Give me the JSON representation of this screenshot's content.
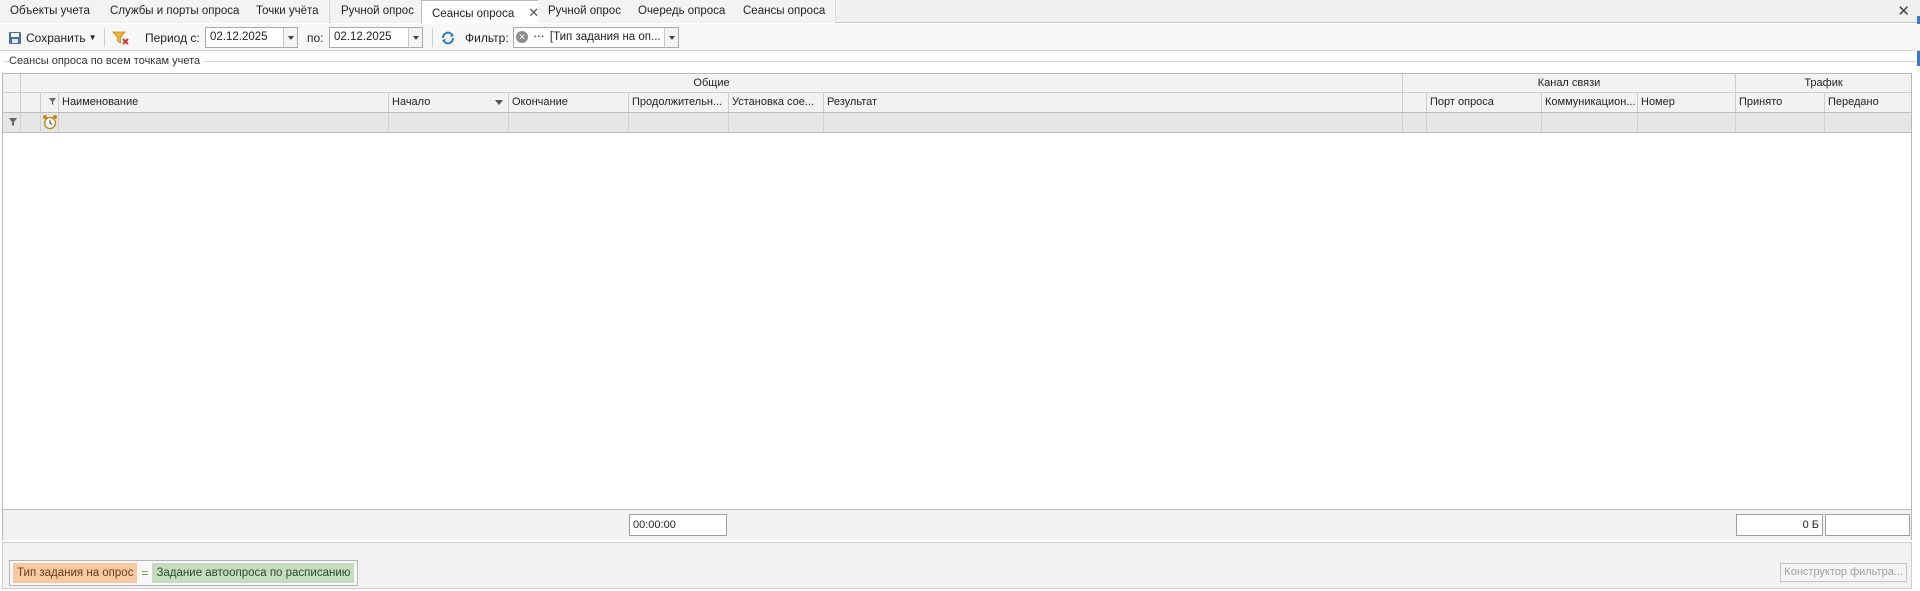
{
  "tabs": [
    {
      "label": "Объекты учета",
      "active": false
    },
    {
      "label": "Службы и порты опроса",
      "active": false
    },
    {
      "label": "Точки учёта",
      "active": false
    },
    {
      "label": "Ручной опрос",
      "active": false
    },
    {
      "label": "Сеансы опроса",
      "active": true
    },
    {
      "label": "Ручной опрос",
      "active": false
    },
    {
      "label": "Очередь опроса",
      "active": false
    },
    {
      "label": "Сеансы опроса",
      "active": false
    }
  ],
  "toolbar": {
    "save_label": "Сохранить",
    "period_from_label": "Период с:",
    "period_from_value": "02.12.2025",
    "period_to_label": "по:",
    "period_to_value": "02.12.2025",
    "filter_label": "Фильтр:",
    "filter_value": "[Тип задания на оп..."
  },
  "group_caption": "Сеансы опроса по всем точкам учета",
  "grid": {
    "bands": {
      "general": "Общие",
      "channel": "Канал связи",
      "traffic": "Трафик"
    },
    "columns": {
      "name": "Наименование",
      "start": "Начало",
      "end": "Окончание",
      "duration": "Продолжительн...",
      "connect": "Установка сое...",
      "result": "Результат",
      "port": "Порт опроса",
      "comm": "Коммуникацион...",
      "number": "Номер",
      "received": "Принято",
      "sent": "Передано"
    },
    "footer": {
      "duration_total": "00:00:00",
      "received_total": "0 Б",
      "sent_total": ""
    }
  },
  "filter_panel": {
    "field": "Тип задания на опрос",
    "operator": "=",
    "value": "Задание автоопроса по расписанию",
    "builder_button": "Конструктор фильтра..."
  },
  "colors": {
    "chip_field": "#f7c9a0",
    "chip_value": "#c6dcc0",
    "accent": "#3c78c8"
  }
}
